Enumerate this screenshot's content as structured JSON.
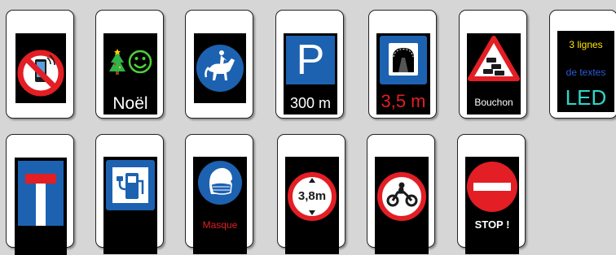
{
  "signs": {
    "noel": {
      "text": "Noël"
    },
    "parking": {
      "letter": "P",
      "distance": "300 m"
    },
    "tunnel": {
      "height": "3,5 m"
    },
    "bouchon": {
      "text": "Bouchon"
    },
    "lignes": {
      "line1": "3 lignes",
      "line2": "de textes",
      "line3": "LED"
    },
    "masque": {
      "text": "Masque"
    },
    "hauteur": {
      "value": "3,8m"
    },
    "stop": {
      "text": "STOP !"
    }
  },
  "colors": {
    "background": "#d6d6d6",
    "card": "#ffffff",
    "screen": "#000000",
    "sign_red": "#e31e24",
    "sign_blue": "#1c62b1",
    "led_yellow": "#ffe600",
    "led_blue": "#2a5bd7",
    "led_cyan": "#2fd6c8",
    "led_green": "#4cd137"
  },
  "icons": [
    "no-phone-icon",
    "christmas-tree-icon",
    "smiley-icon",
    "horse-rider-icon",
    "parking-icon",
    "tunnel-icon",
    "traffic-jam-icon",
    "dead-end-icon",
    "charging-station-icon",
    "face-mask-icon",
    "height-limit-icon",
    "no-motorcycle-icon",
    "no-entry-icon"
  ]
}
